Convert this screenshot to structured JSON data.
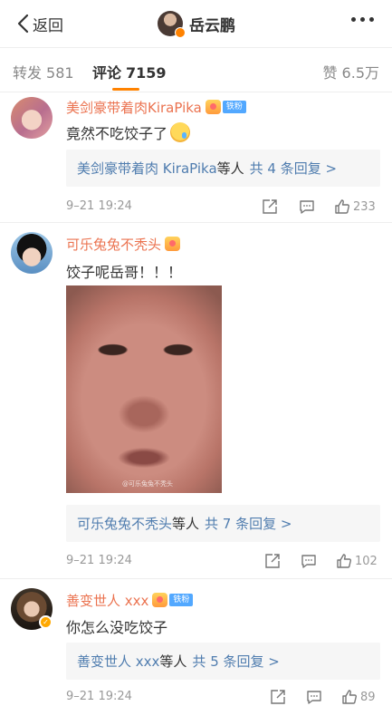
{
  "nav": {
    "back_label": "返回",
    "title": "岳云鹏"
  },
  "tabs": {
    "repost": {
      "label": "转发",
      "count": "581"
    },
    "comment": {
      "label": "评论",
      "count": "7159"
    },
    "like": {
      "label": "赞",
      "count": "6.5万"
    }
  },
  "comments": [
    {
      "username": "美剑豪带着肉KiraPika",
      "badge": "铁粉",
      "text": "竟然不吃饺子了",
      "reply_summary": {
        "names": "美剑豪带着肉 KiraPika",
        "mid": "等人",
        "count_text": "共 4 条回复 >"
      },
      "time": "9–21 19:24",
      "likes": "233"
    },
    {
      "username": "可乐兔兔不秃头",
      "badge": "",
      "text": "饺子呢岳哥！！！",
      "photo_watermark": "@可乐兔兔不秃头",
      "reply_summary": {
        "names": "可乐兔兔不秃头",
        "mid": "等人",
        "count_text": "共 7 条回复 >"
      },
      "time": "9–21 19:24",
      "likes": "102"
    },
    {
      "username": "善变世人 xxx",
      "badge": "铁粉",
      "text": "你怎么没吃饺子",
      "reply_summary": {
        "names": "善变世人 xxx",
        "mid": "等人",
        "count_text": "共 5 条回复 >"
      },
      "time": "9–21 19:24",
      "likes": "89"
    }
  ],
  "colors": {
    "accent": "#ff8200",
    "username": "#eb7350",
    "link": "#507daf",
    "muted": "#999999"
  },
  "icons": [
    "back-arrow-icon",
    "more-icon",
    "vip-icon",
    "tear-emoji-icon",
    "share-icon",
    "comment-icon",
    "like-icon",
    "verified-badge-icon"
  ]
}
